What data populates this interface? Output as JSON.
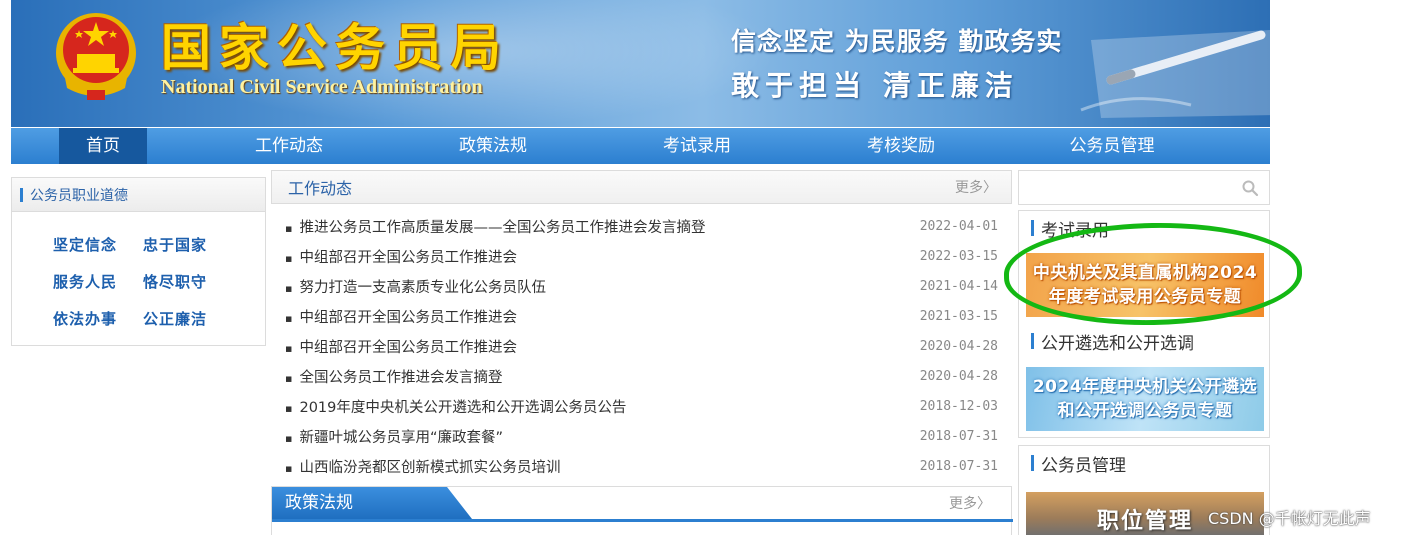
{
  "header": {
    "title": "国家公务员局",
    "subtitle": "National Civil Service Administration",
    "slogan_line1": "信念坚定 为民服务 勤政务实",
    "slogan_line2": "敢于担当 清正廉洁"
  },
  "nav": {
    "items": [
      "首页",
      "工作动态",
      "政策法规",
      "考试录用",
      "考核奖励",
      "公务员管理"
    ],
    "active": "首页"
  },
  "ethics": {
    "title": "公务员职业道德",
    "items": [
      "坚定信念",
      "忠于国家",
      "服务人民",
      "恪尽职守",
      "依法办事",
      "公正廉洁"
    ]
  },
  "news": {
    "title": "工作动态",
    "more": "更多〉",
    "items": [
      {
        "title": "推进公务员工作高质量发展——全国公务员工作推进会发言摘登",
        "date": "2022-04-01"
      },
      {
        "title": "中组部召开全国公务员工作推进会",
        "date": "2022-03-15"
      },
      {
        "title": "努力打造一支高素质专业化公务员队伍",
        "date": "2021-04-14"
      },
      {
        "title": "中组部召开全国公务员工作推进会",
        "date": "2021-03-15"
      },
      {
        "title": "中组部召开全国公务员工作推进会",
        "date": "2020-04-28"
      },
      {
        "title": "全国公务员工作推进会发言摘登",
        "date": "2020-04-28"
      },
      {
        "title": "2019年度中央机关公开遴选和公开选调公务员公告",
        "date": "2018-12-03"
      },
      {
        "title": "新疆叶城公务员享用“廉政套餐”",
        "date": "2018-07-31"
      },
      {
        "title": "山西临汾尧都区创新模式抓实公务员培训",
        "date": "2018-07-31"
      }
    ]
  },
  "policy": {
    "title": "政策法规",
    "more": "更多〉"
  },
  "search": {
    "placeholder": "",
    "icon": "search-icon"
  },
  "exam": {
    "title": "考试录用",
    "banner_line1": "中央机关及其直属机构2024",
    "banner_line2": "年度考试录用公务员专题"
  },
  "selection": {
    "title": "公开遴选和公开选调",
    "banner_line1": "2024年度中央机关公开遴选",
    "banner_line2": "和公开选调公务员专题"
  },
  "management": {
    "title": "公务员管理",
    "banner_text": "职位管理"
  },
  "watermark": "CSDN @千帐灯无此声",
  "colors": {
    "nav_blue": "#2c7fd0",
    "active_nav": "#16589e",
    "highlight_circle": "#14b814",
    "title_gold": "#ffd400"
  }
}
